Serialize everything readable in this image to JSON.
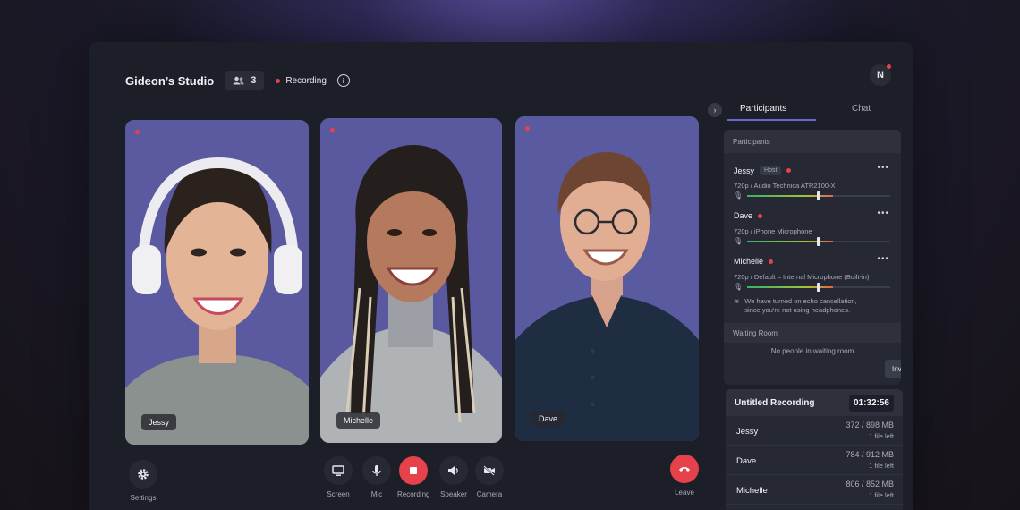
{
  "header": {
    "studio_name": "Gideon’s Studio",
    "participant_count": "3",
    "recording_label": "Recording",
    "info_icon": "i",
    "avatar_initial": "N"
  },
  "videos": [
    {
      "name": "Jessy",
      "live": true
    },
    {
      "name": "Michelle",
      "live": true
    },
    {
      "name": "Dave",
      "live": true
    }
  ],
  "controls": {
    "settings": "Settings",
    "screen": "Screen",
    "mic": "Mic",
    "recording": "Recording",
    "speaker": "Speaker",
    "camera": "Camera",
    "leave": "Leave"
  },
  "side_panel": {
    "tab_participants": "Participants",
    "tab_chat": "Chat",
    "section_title": "Participants",
    "participants": [
      {
        "name": "Jessy",
        "badge": "Host",
        "device": "720p / Audio Technica ATR2100-X",
        "level": 0.5
      },
      {
        "name": "Dave",
        "badge": "",
        "device": "720p / iPhone Microphone",
        "level": 0.5
      },
      {
        "name": "Michelle",
        "badge": "",
        "device": "720p / Default – Internal Microphone (Built-in)",
        "level": 0.5
      }
    ],
    "echo_note_line1": "We have turned on echo cancellation,",
    "echo_note_line2": "since you're not using headphones.",
    "waiting_title": "Waiting Room",
    "waiting_empty": "No people in waiting room",
    "invite_label": "Inv"
  },
  "recording_card": {
    "title": "Untitled Recording",
    "timer": "01:32:56",
    "rows": [
      {
        "name": "Jessy",
        "size": "372 / 898 MB",
        "files": "1 file left"
      },
      {
        "name": "Dave",
        "size": "784 / 912 MB",
        "files": "1 file left"
      },
      {
        "name": "Michelle",
        "size": "806 / 852 MB",
        "files": "1 file left"
      }
    ]
  },
  "colors": {
    "accent": "#6f62d6",
    "record_red": "#e5424b",
    "tile_bg": "#58589a"
  }
}
